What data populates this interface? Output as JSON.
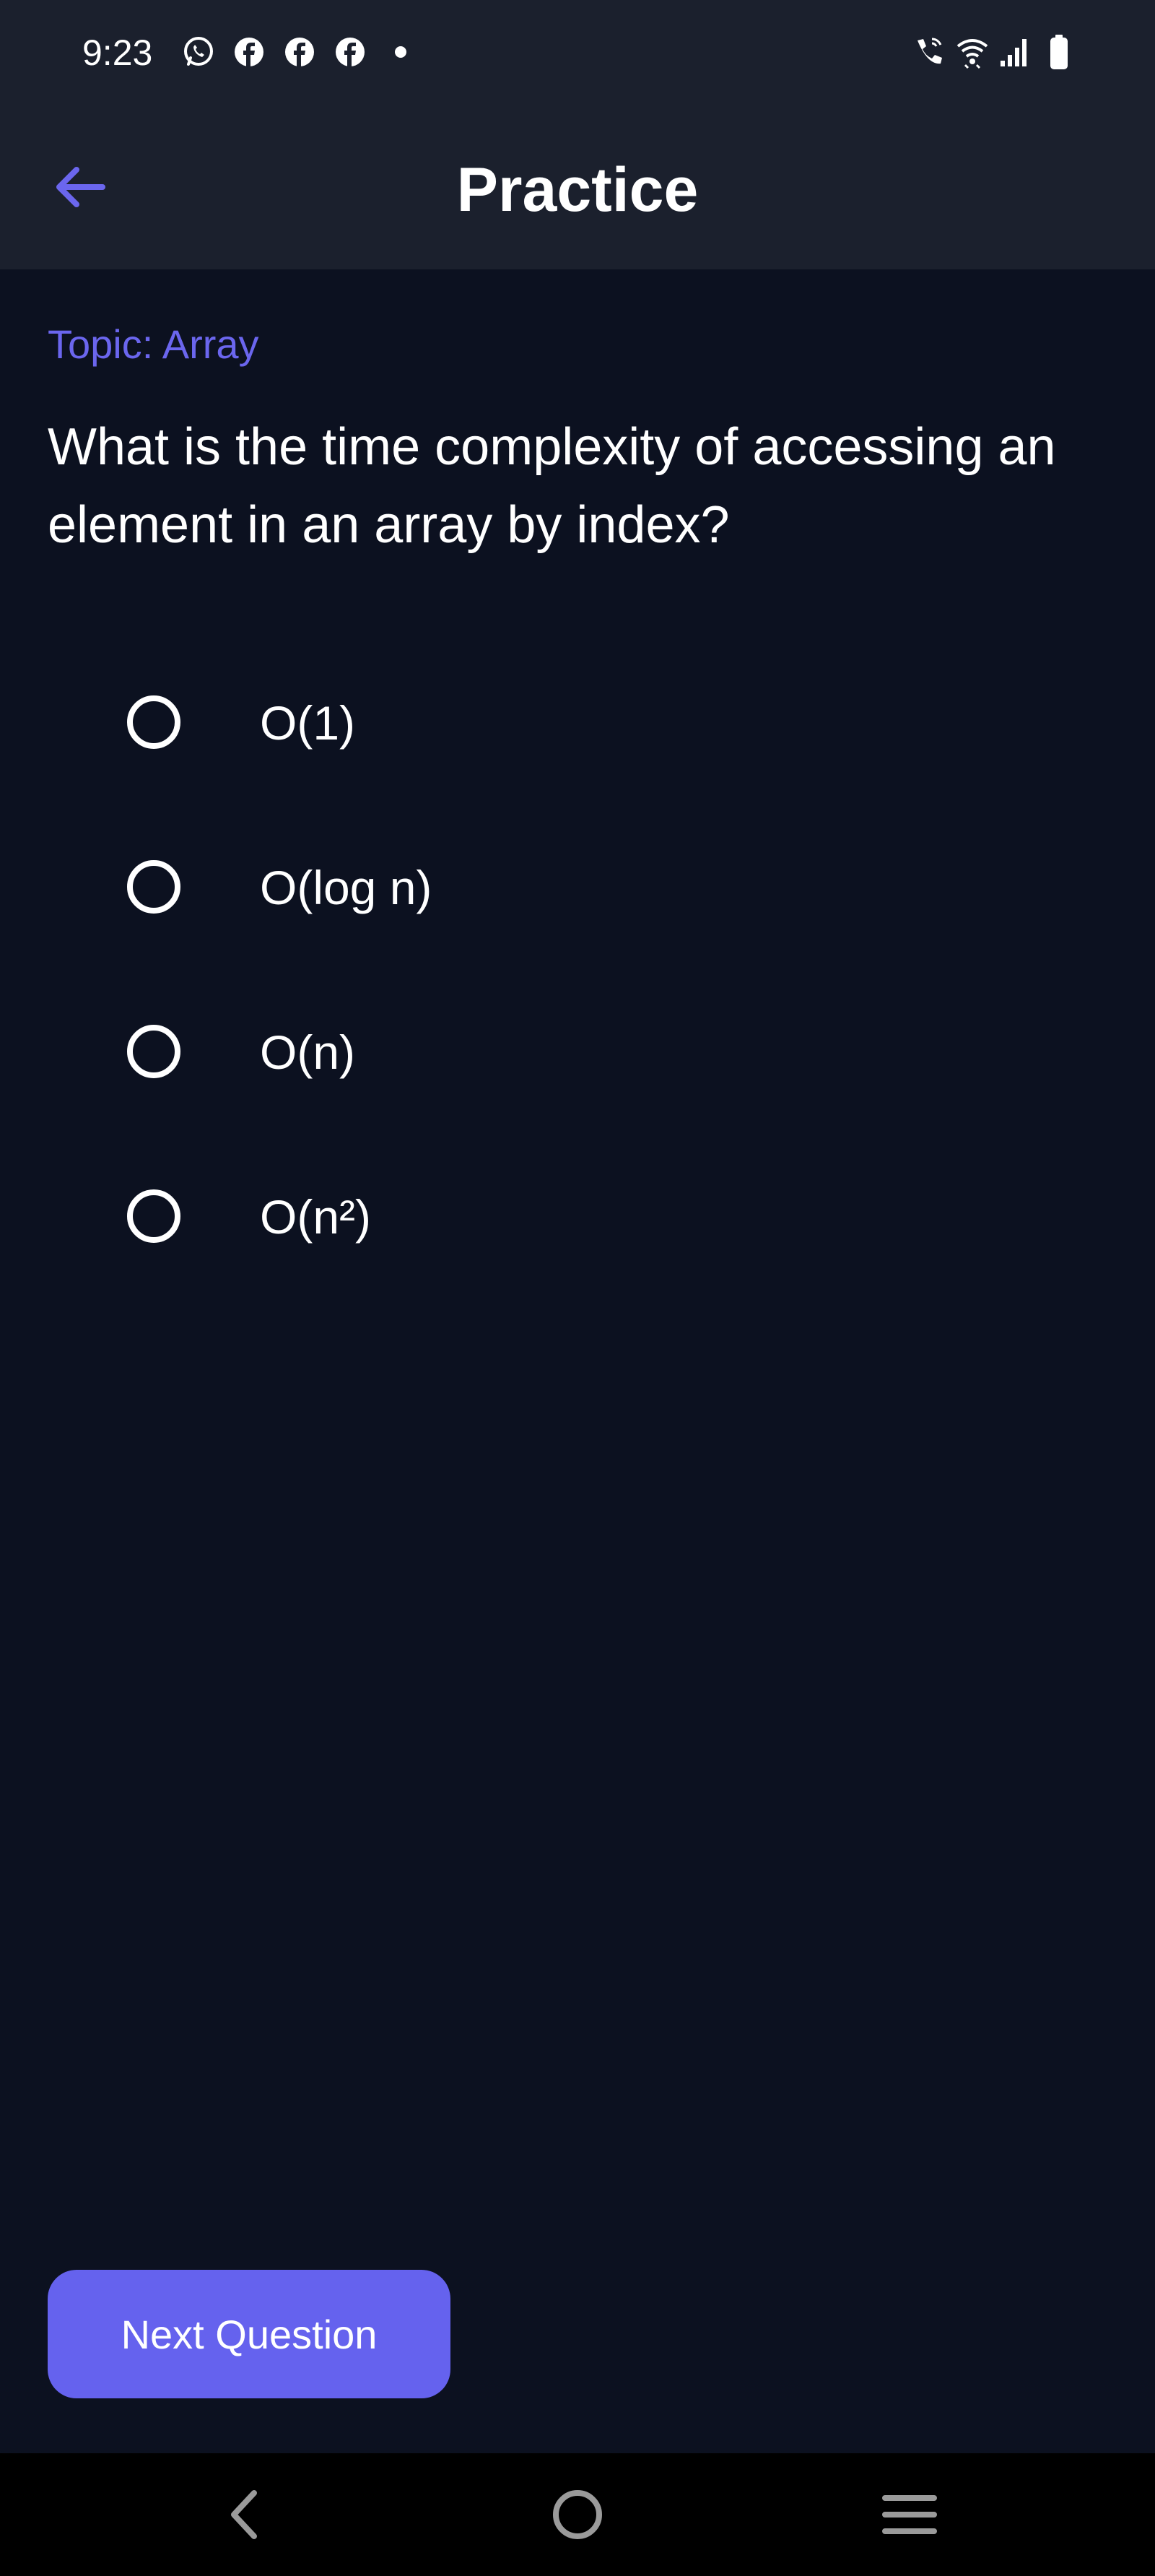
{
  "status_bar": {
    "time": "9:23",
    "left_icons": [
      "whatsapp-icon",
      "facebook-icon",
      "facebook-icon",
      "facebook-icon",
      "notification-dot-icon"
    ],
    "right_icons": [
      "wifi-call-icon",
      "wifi-icon",
      "signal-icon",
      "battery-icon"
    ]
  },
  "app_bar": {
    "title": "Practice",
    "back_icon": "arrow-left-icon"
  },
  "quiz": {
    "topic": "Topic: Array",
    "question": "What is the time complexity of accessing an element in an array by index?",
    "options": [
      {
        "label": "O(1)",
        "selected": false
      },
      {
        "label": "O(log n)",
        "selected": false
      },
      {
        "label": "O(n)",
        "selected": false
      },
      {
        "label": "O(n²)",
        "selected": false
      }
    ]
  },
  "actions": {
    "next_label": "Next Question"
  },
  "nav_bar": {
    "icons": [
      "back-icon",
      "home-icon",
      "recents-icon"
    ]
  },
  "colors": {
    "background": "#0c1120",
    "header": "#1b202d",
    "accent": "#6562ee",
    "text": "#ffffff"
  }
}
